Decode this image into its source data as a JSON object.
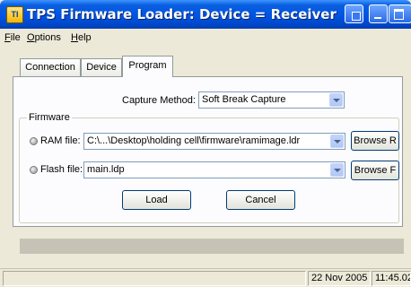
{
  "window": {
    "title": "TPS Firmware Loader:  Device = Receiver",
    "icon": "app-chip-icon"
  },
  "menu": [
    {
      "label": "File",
      "accel": "F"
    },
    {
      "label": "Options",
      "accel": "O"
    },
    {
      "label": "Help",
      "accel": "H"
    }
  ],
  "tabs": [
    {
      "label": "Connection"
    },
    {
      "label": "Device"
    },
    {
      "label": "Program",
      "active": true
    }
  ],
  "capture": {
    "label": "Capture Method:",
    "value": "Soft Break Capture"
  },
  "firmware": {
    "group_title": "Firmware",
    "ram": {
      "label": "RAM file:",
      "value": "C:\\...\\Desktop\\holding cell\\firmware\\ramimage.ldr",
      "browse_label": "Browse R"
    },
    "flash": {
      "label": "Flash file:",
      "value": "main.ldp",
      "browse_label": "Browse F"
    }
  },
  "buttons": {
    "load": "Load",
    "cancel": "Cancel"
  },
  "status": {
    "date": "22 Nov 2005",
    "time": "11:45.02"
  },
  "colors": {
    "title_blue": "#0054e3",
    "face": "#ece9d8",
    "panel": "#fcfcfe"
  }
}
